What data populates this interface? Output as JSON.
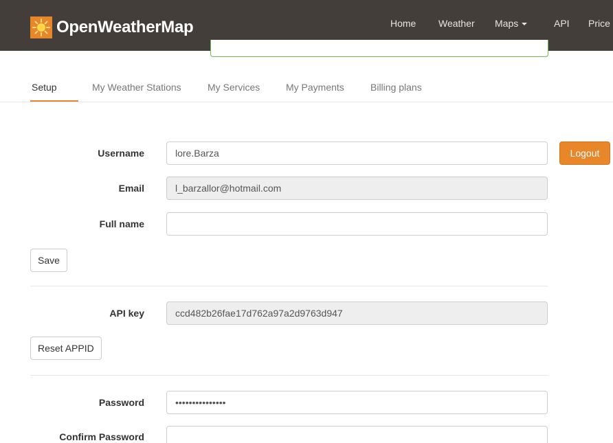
{
  "brand": {
    "name": "OpenWeatherMap",
    "logo_icon": "sun-icon",
    "accent": "#e8862a"
  },
  "nav": {
    "home": "Home",
    "weather": "Weather",
    "maps": "Maps",
    "api": "API",
    "price": "Price"
  },
  "tabs": [
    "Setup",
    "My Weather Stations",
    "My Services",
    "My Payments",
    "Billing plans"
  ],
  "form": {
    "username_label": "Username",
    "username_value": "lore.Barza",
    "email_label": "Email",
    "email_value": "l_barzallor@hotmail.com",
    "fullname_label": "Full name",
    "fullname_value": "",
    "save_label": "Save",
    "logout_label": "Logout",
    "apikey_label": "API key",
    "apikey_value": "ccd482b26fae17d762a97a2d9763d947",
    "reset_label": "Reset APPID",
    "password_label": "Password",
    "password_value": "•••••••••••••••",
    "confirm_label": "Confirm Password",
    "confirm_value": ""
  }
}
